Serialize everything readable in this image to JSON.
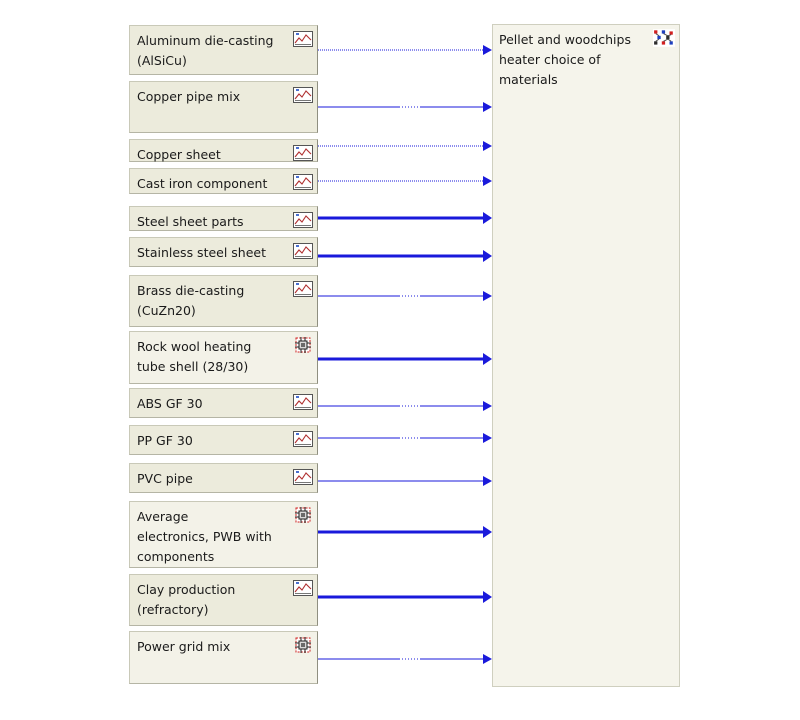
{
  "target": {
    "label": "Pellet and woodchips\nheater choice of materials",
    "icon": "product-system-icon"
  },
  "processes": [
    {
      "id": "aluminum-die-casting",
      "label": "Aluminum die-casting\n(AlSiCu)",
      "icon": "chart-icon",
      "flow": "thin-dotted"
    },
    {
      "id": "copper-pipe-mix",
      "label": "Copper pipe mix",
      "icon": "chart-icon",
      "flow": "thin-dashed"
    },
    {
      "id": "copper-sheet",
      "label": "Copper sheet",
      "icon": "chart-icon",
      "flow": "thin-dotted"
    },
    {
      "id": "cast-iron-component",
      "label": "Cast iron component",
      "icon": "chart-icon",
      "flow": "thin-dotted"
    },
    {
      "id": "steel-sheet-parts",
      "label": "Steel sheet parts",
      "icon": "chart-icon",
      "flow": "thick"
    },
    {
      "id": "stainless-steel-sheet",
      "label": "Stainless steel sheet",
      "icon": "chart-icon",
      "flow": "thick"
    },
    {
      "id": "brass-die-casting",
      "label": "Brass die-casting\n(CuZn20)",
      "icon": "chart-icon",
      "flow": "thin-dashed"
    },
    {
      "id": "rock-wool-heating-tube-shell",
      "label": "Rock wool heating\ntube shell (28/30)",
      "icon": "circuit-icon",
      "flow": "thick"
    },
    {
      "id": "abs-gf-30",
      "label": "ABS GF 30",
      "icon": "chart-icon",
      "flow": "thin-dashed"
    },
    {
      "id": "pp-gf-30",
      "label": "PP GF 30",
      "icon": "chart-icon",
      "flow": "thin-dashed"
    },
    {
      "id": "pvc-pipe",
      "label": "PVC pipe",
      "icon": "chart-icon",
      "flow": "thin"
    },
    {
      "id": "average-electronics-pwb",
      "label": "Average\nelectronics, PWB with\ncomponents",
      "icon": "circuit-icon",
      "flow": "thick"
    },
    {
      "id": "clay-production",
      "label": "Clay production\n(refractory)",
      "icon": "chart-icon",
      "flow": "thick"
    },
    {
      "id": "power-grid-mix",
      "label": "Power grid mix",
      "icon": "circuit-icon",
      "flow": "thin-dashed"
    }
  ],
  "colors": {
    "flow": "#1a1adb",
    "node_fill": "#ecebdc",
    "node_fill_alt": "#f3f2e8",
    "target_fill": "#f5f4eb"
  }
}
